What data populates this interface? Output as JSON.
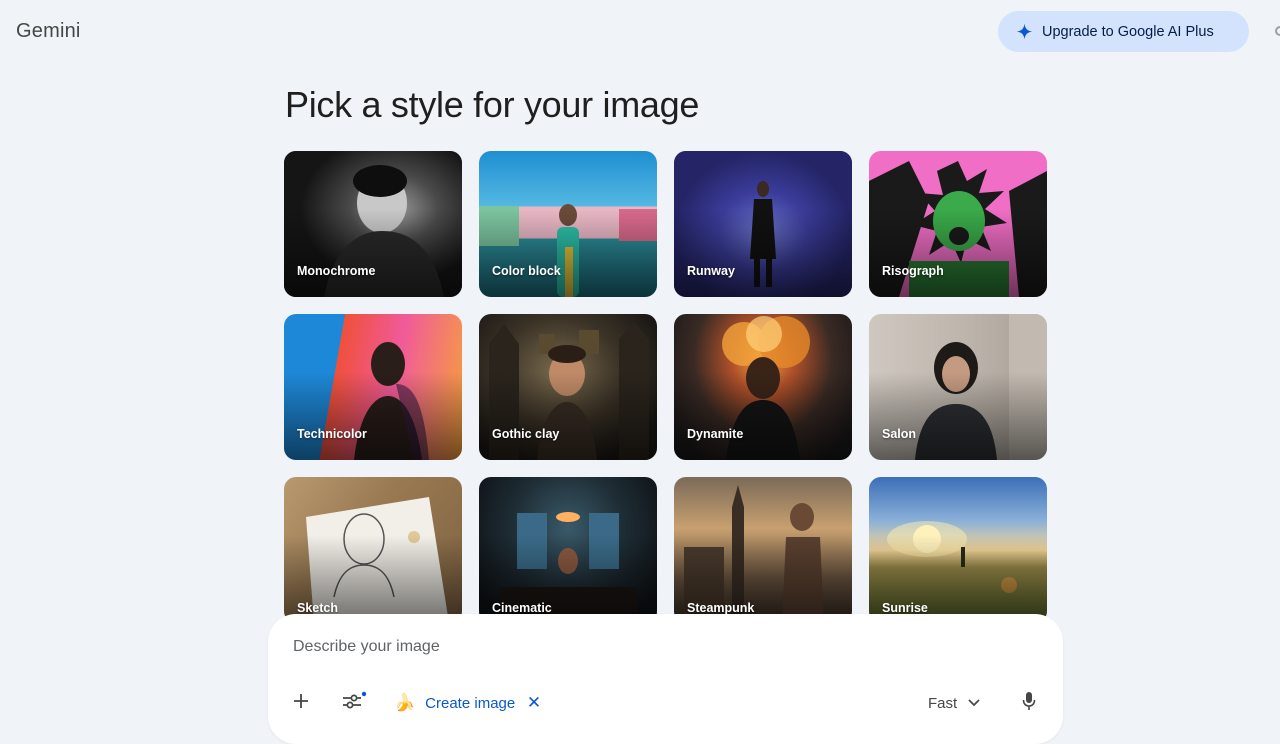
{
  "app": {
    "title": "Gemini"
  },
  "header": {
    "upgrade_label": "Upgrade to Google AI Plus"
  },
  "main": {
    "title": "Pick a style for your image",
    "styles": [
      {
        "label": "Monochrome"
      },
      {
        "label": "Color block"
      },
      {
        "label": "Runway"
      },
      {
        "label": "Risograph"
      },
      {
        "label": "Technicolor"
      },
      {
        "label": "Gothic clay"
      },
      {
        "label": "Dynamite"
      },
      {
        "label": "Salon"
      },
      {
        "label": "Sketch"
      },
      {
        "label": "Cinematic"
      },
      {
        "label": "Steampunk"
      },
      {
        "label": "Sunrise"
      }
    ]
  },
  "composer": {
    "placeholder": "Describe your image",
    "chip_label": "Create image",
    "chip_icon": "banana-icon",
    "model_label": "Fast"
  },
  "colors": {
    "background": "#f0f4f9",
    "upgrade_bg": "#d3e3fd",
    "accent": "#0b57d0"
  }
}
